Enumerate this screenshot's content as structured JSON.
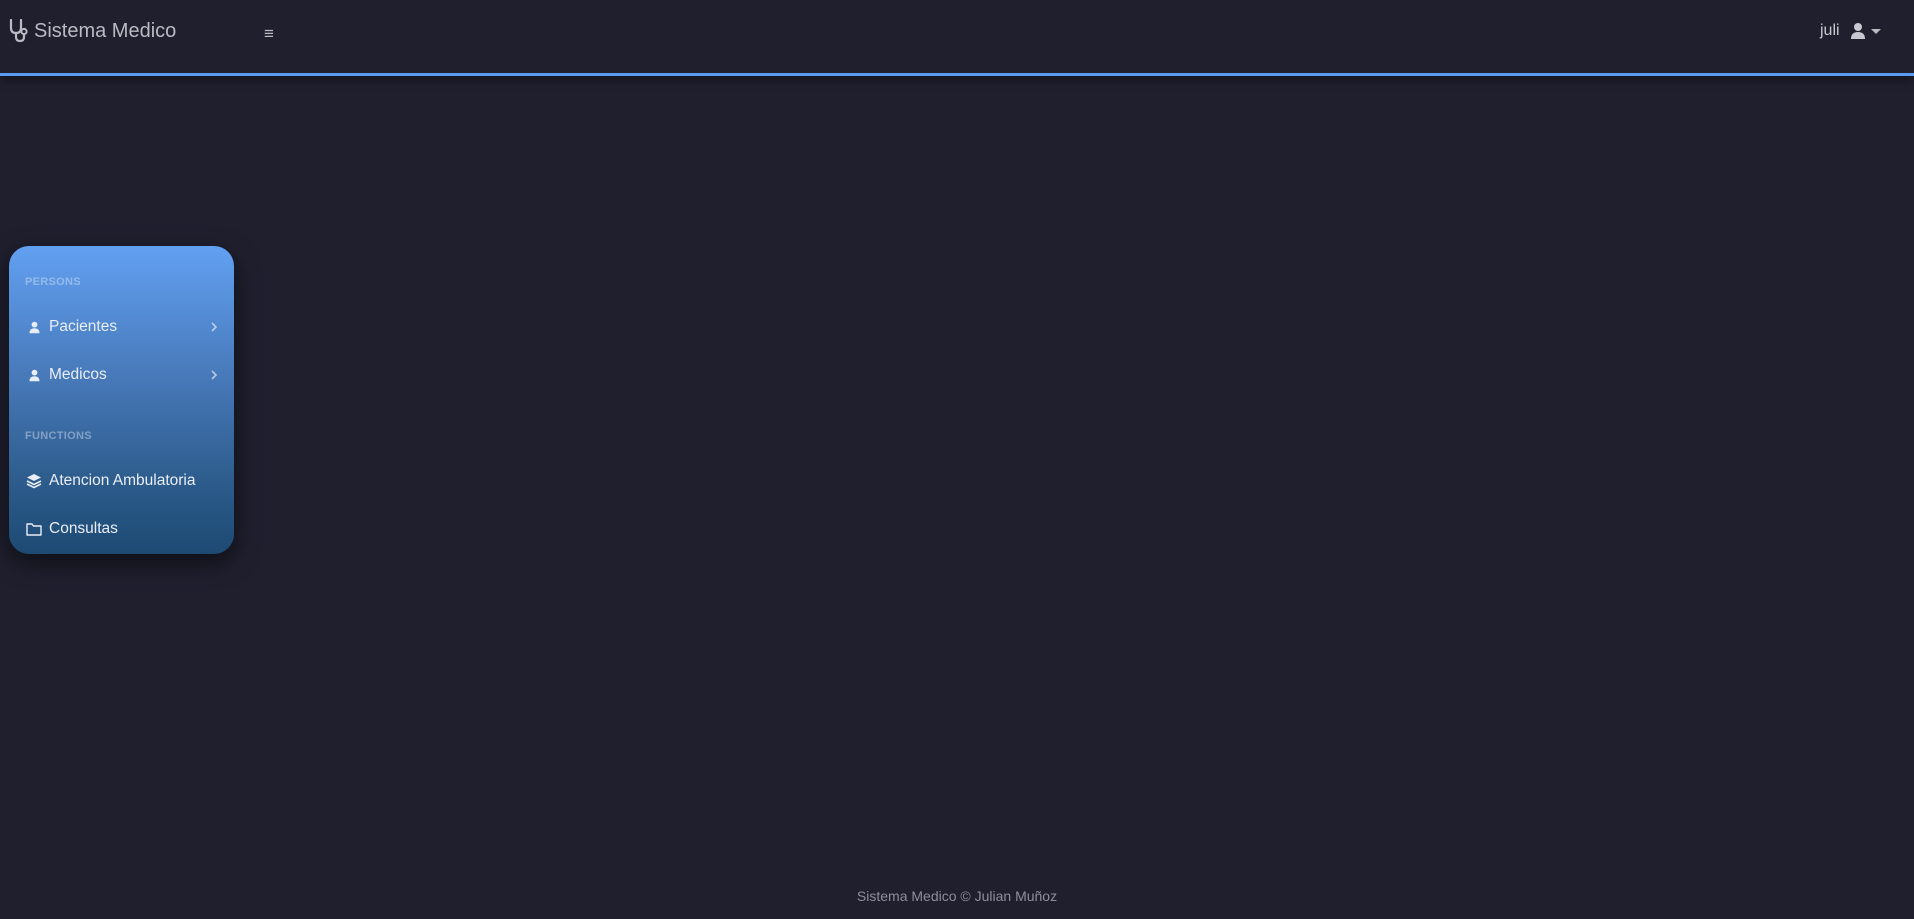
{
  "navbar": {
    "brand": "Sistema Medico",
    "brand_icon": "stethoscope-icon",
    "menu_toggle_glyph": "≡",
    "user": {
      "name": "juli",
      "icon": "user-icon"
    }
  },
  "sidebar": {
    "sections": [
      {
        "heading": "PERSONS",
        "items": [
          {
            "label": "Pacientes",
            "icon": "user-icon",
            "has_submenu": true
          },
          {
            "label": "Medicos",
            "icon": "user-icon",
            "has_submenu": true
          }
        ]
      },
      {
        "heading": "FUNCTIONS",
        "items": [
          {
            "label": "Atencion Ambulatoria",
            "icon": "layers-icon",
            "has_submenu": false
          },
          {
            "label": "Consultas",
            "icon": "folder-icon",
            "has_submenu": false
          }
        ]
      }
    ]
  },
  "footer": {
    "text": "Sistema Medico © Julian Muñoz"
  },
  "colors": {
    "background": "#1f1f2e",
    "accent": "#5b9bef",
    "sidebar_top": "#62a0f2",
    "sidebar_bottom": "#1d4a73"
  }
}
